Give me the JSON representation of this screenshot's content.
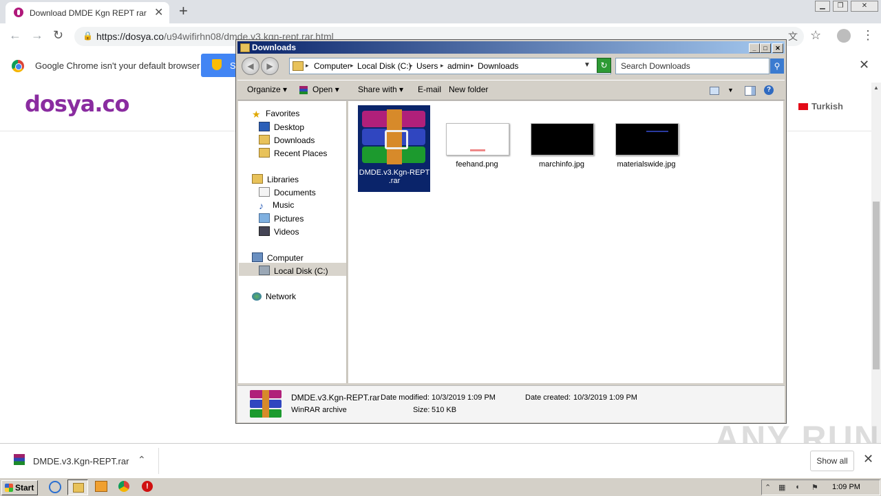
{
  "browser": {
    "tab_title": "Download DMDE Kgn REPT rar",
    "url_domain": "https://dosya.co",
    "url_path": "/u94wifirhn08/dmde.v3.kgn-rept.rar.html",
    "infobar": {
      "message": "Google Chrome isn't your default browser",
      "set_default_label": "S"
    }
  },
  "site": {
    "logo": "dosya.co",
    "language": "Turkish"
  },
  "download_shelf": {
    "file_name": "DMDE.v3.Kgn-REPT.rar",
    "show_all": "Show all"
  },
  "watermark": "ANY RUN",
  "explorer": {
    "title": "Downloads",
    "breadcrumb": [
      "Computer",
      "Local Disk (C:)",
      "Users",
      "admin",
      "Downloads"
    ],
    "search_placeholder": "Search Downloads",
    "commands": [
      "Organize",
      "Open",
      "Share with",
      "E-mail",
      "New folder"
    ],
    "nav": {
      "favorites": "Favorites",
      "desktop": "Desktop",
      "downloads": "Downloads",
      "recent": "Recent Places",
      "libraries": "Libraries",
      "documents": "Documents",
      "music": "Music",
      "pictures": "Pictures",
      "videos": "Videos",
      "computer": "Computer",
      "local_disk": "Local Disk (C:)",
      "network": "Network"
    },
    "files": [
      {
        "name_line1": "DMDE.v3.Kgn-REPT",
        "name_line2": ".rar",
        "selected": true
      },
      {
        "name": "feehand.png"
      },
      {
        "name": "marchinfo.jpg"
      },
      {
        "name": "materialswide.jpg"
      }
    ],
    "details": {
      "name": "DMDE.v3.Kgn-REPT.rar",
      "type": "WinRAR archive",
      "modified_label": "Date modified:",
      "modified": "10/3/2019 1:09 PM",
      "created_label": "Date created:",
      "created": "10/3/2019 1:09 PM",
      "size_label": "Size:",
      "size": "510 KB"
    }
  },
  "taskbar": {
    "start": "Start",
    "clock": "1:09 PM"
  },
  "colors": {
    "logo_purple": "#8a2ca0",
    "selection_blue": "#0a246a",
    "chrome_blue": "#4285f4"
  }
}
